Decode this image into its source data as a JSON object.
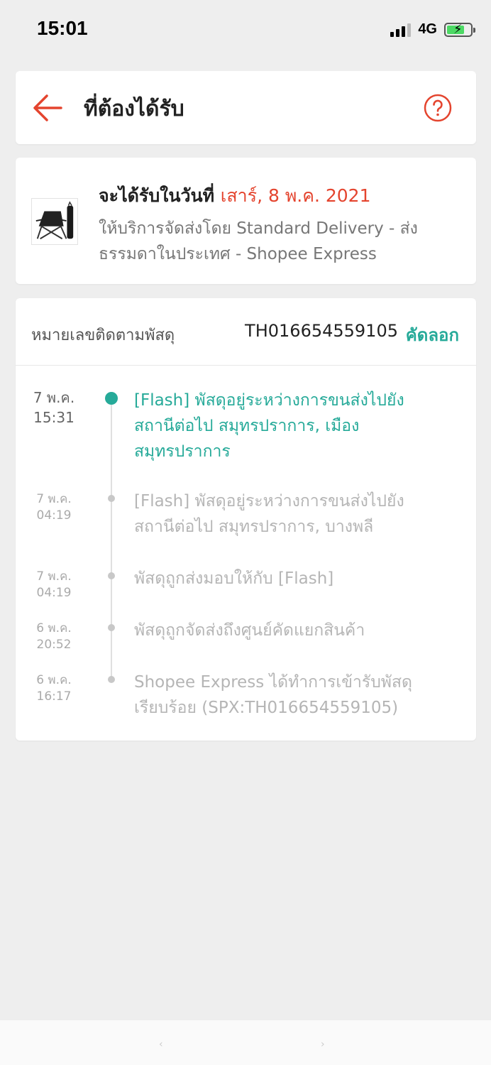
{
  "status_bar": {
    "time": "15:01",
    "network": "4G",
    "battery_level": 0.7,
    "icons": [
      "signal-icon",
      "battery-charging-icon"
    ]
  },
  "header": {
    "title": "ที่ต้องได้รับ",
    "back_icon": "arrow-left-icon",
    "help_icon": "question-circle-icon"
  },
  "delivery": {
    "label": "จะได้รับในวันที่ ",
    "date": "เสาร์, 8 พ.ค. 2021",
    "description": "ให้บริการจัดส่งโดย Standard Delivery - ส่งธรรมดาในประเทศ - Shopee Express"
  },
  "tracking": {
    "label": "หมายเลขติดตามพัสดุ",
    "number": "TH016654559105",
    "copy_label": "คัดลอก",
    "events": [
      {
        "date": "7 พ.ค.",
        "time": "15:31",
        "text": "[Flash] พัสดุอยู่ระหว่างการขนส่งไปยังสถานีต่อไป  สมุทรปราการ, เมืองสมุทรปราการ",
        "active": true
      },
      {
        "date": "7 พ.ค.",
        "time": "04:19",
        "text": "[Flash] พัสดุอยู่ระหว่างการขนส่งไปยังสถานีต่อไป  สมุทรปราการ, บางพลี",
        "active": false
      },
      {
        "date": "7 พ.ค.",
        "time": "04:19",
        "text": "พัสดุถูกส่งมอบให้กับ [Flash]",
        "active": false
      },
      {
        "date": "6 พ.ค.",
        "time": "20:52",
        "text": "พัสดุถูกจัดส่งถึงศูนย์คัดแยกสินค้า",
        "active": false
      },
      {
        "date": "6 พ.ค.",
        "time": "16:17",
        "text": "Shopee Express ได้ทำการเข้ารับพัสดุเรียบร้อย (SPX:TH016654559105)",
        "active": false
      }
    ]
  },
  "colors": {
    "accent_orange": "#e4442e",
    "accent_teal": "#26aa99",
    "background": "#eeeeee"
  }
}
